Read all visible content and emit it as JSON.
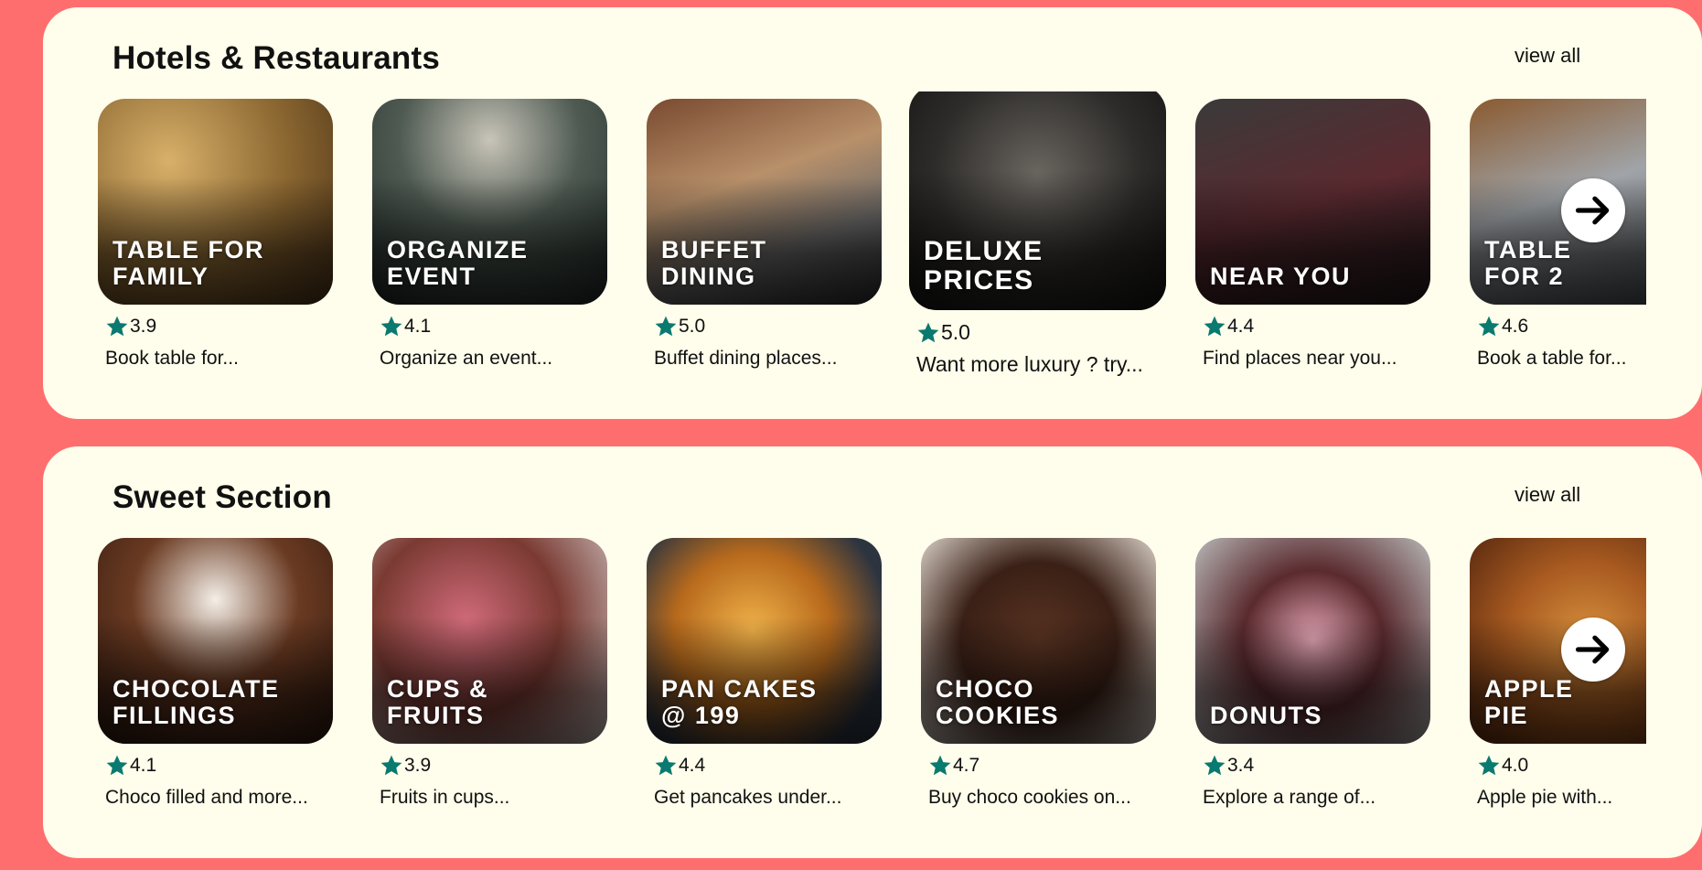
{
  "sections": [
    {
      "title": "Hotels & Restaurants",
      "view_all": "view all",
      "cards": [
        {
          "overlay": "TABLE FOR\nFAMILY",
          "rating": "3.9",
          "desc": "Book table for..."
        },
        {
          "overlay": "ORGANIZE\nEVENT",
          "rating": "4.1",
          "desc": "Organize an event..."
        },
        {
          "overlay": "BUFFET\nDINING",
          "rating": "5.0",
          "desc": "Buffet dining places..."
        },
        {
          "overlay": "DELUXE\nPRICES",
          "rating": "5.0",
          "desc": "Want more luxury ? try..."
        },
        {
          "overlay": "NEAR YOU",
          "rating": "4.4",
          "desc": "Find places near you..."
        },
        {
          "overlay": "TABLE\nFOR 2",
          "rating": "4.6",
          "desc": "Book a table for..."
        }
      ]
    },
    {
      "title": "Sweet Section",
      "view_all": "view all",
      "cards": [
        {
          "overlay": "CHOCOLATE\nFILLINGS",
          "rating": "4.1",
          "desc": "Choco filled and more..."
        },
        {
          "overlay": "CUPS &\nFRUITS",
          "rating": "3.9",
          "desc": "Fruits in cups..."
        },
        {
          "overlay": "PAN CAKES\n@ 199",
          "rating": "4.4",
          "desc": "Get pancakes under..."
        },
        {
          "overlay": "CHOCO\nCOOKIES",
          "rating": "4.7",
          "desc": "Buy choco cookies on..."
        },
        {
          "overlay": "DONUTS",
          "rating": "3.4",
          "desc": "Explore a range of..."
        },
        {
          "overlay": "APPLE\nPIE",
          "rating": "4.0",
          "desc": "Apple pie with..."
        }
      ]
    }
  ],
  "icons": {
    "rating": "star-icon",
    "next": "arrow-right-icon"
  },
  "colors": {
    "background": "#ff6e6e",
    "panel": "#fffdeb",
    "star": "#0a7a70"
  }
}
